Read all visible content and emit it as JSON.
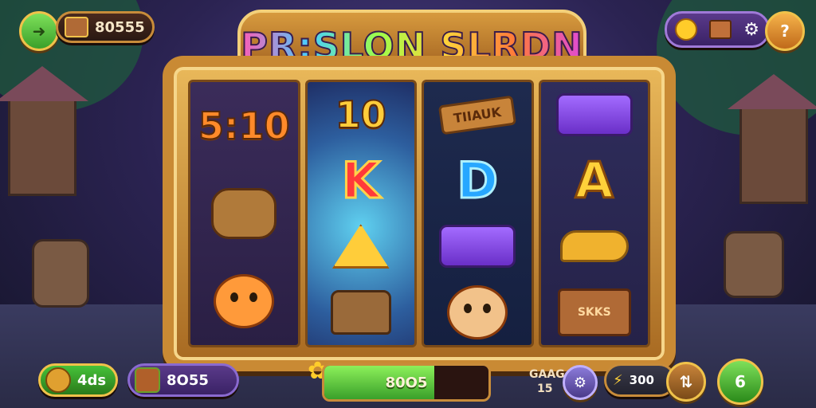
{
  "title": "PR:SLON SLRDN",
  "top_left": {
    "back_icon": "arrow-left-icon",
    "chest_icon": "treasure-chest-icon",
    "balance": "80555"
  },
  "top_right": {
    "coin_icon": "gold-coin-icon",
    "crate_icon": "crate-icon",
    "settings_icon": "gear-icon",
    "help_icon": "question-icon",
    "help_glyph": "?"
  },
  "reels": [
    [
      "5:10",
      "barrel",
      "orange-face"
    ],
    [
      "10",
      "K",
      "triangle-gem",
      "chest"
    ],
    [
      "TIIAUK",
      "D",
      "purple-cart",
      "kid-face"
    ],
    [
      "purple-cart",
      "A",
      "banana",
      "crate"
    ]
  ],
  "reel_labels": {
    "r1_top": "5:10",
    "r2_top": "10",
    "r2_mid": "K",
    "r3_top": "TIIAUK",
    "r3_mid": "D",
    "r4_mid": "A",
    "r4_crate": "SKKS"
  },
  "bottom": {
    "left_value": "4ds",
    "mid_value": "8O55",
    "win_meter": {
      "value": "80O5",
      "fill": 0.67
    },
    "gamble_label": "GAAG",
    "gamble_value": "15",
    "bet_value": "300",
    "spin_value": "6"
  },
  "colors": {
    "accent": "#c88c3a",
    "green_button": "#46c23a",
    "meter_green": "#3aa02a",
    "purple_bar": "#4a2a7a"
  }
}
